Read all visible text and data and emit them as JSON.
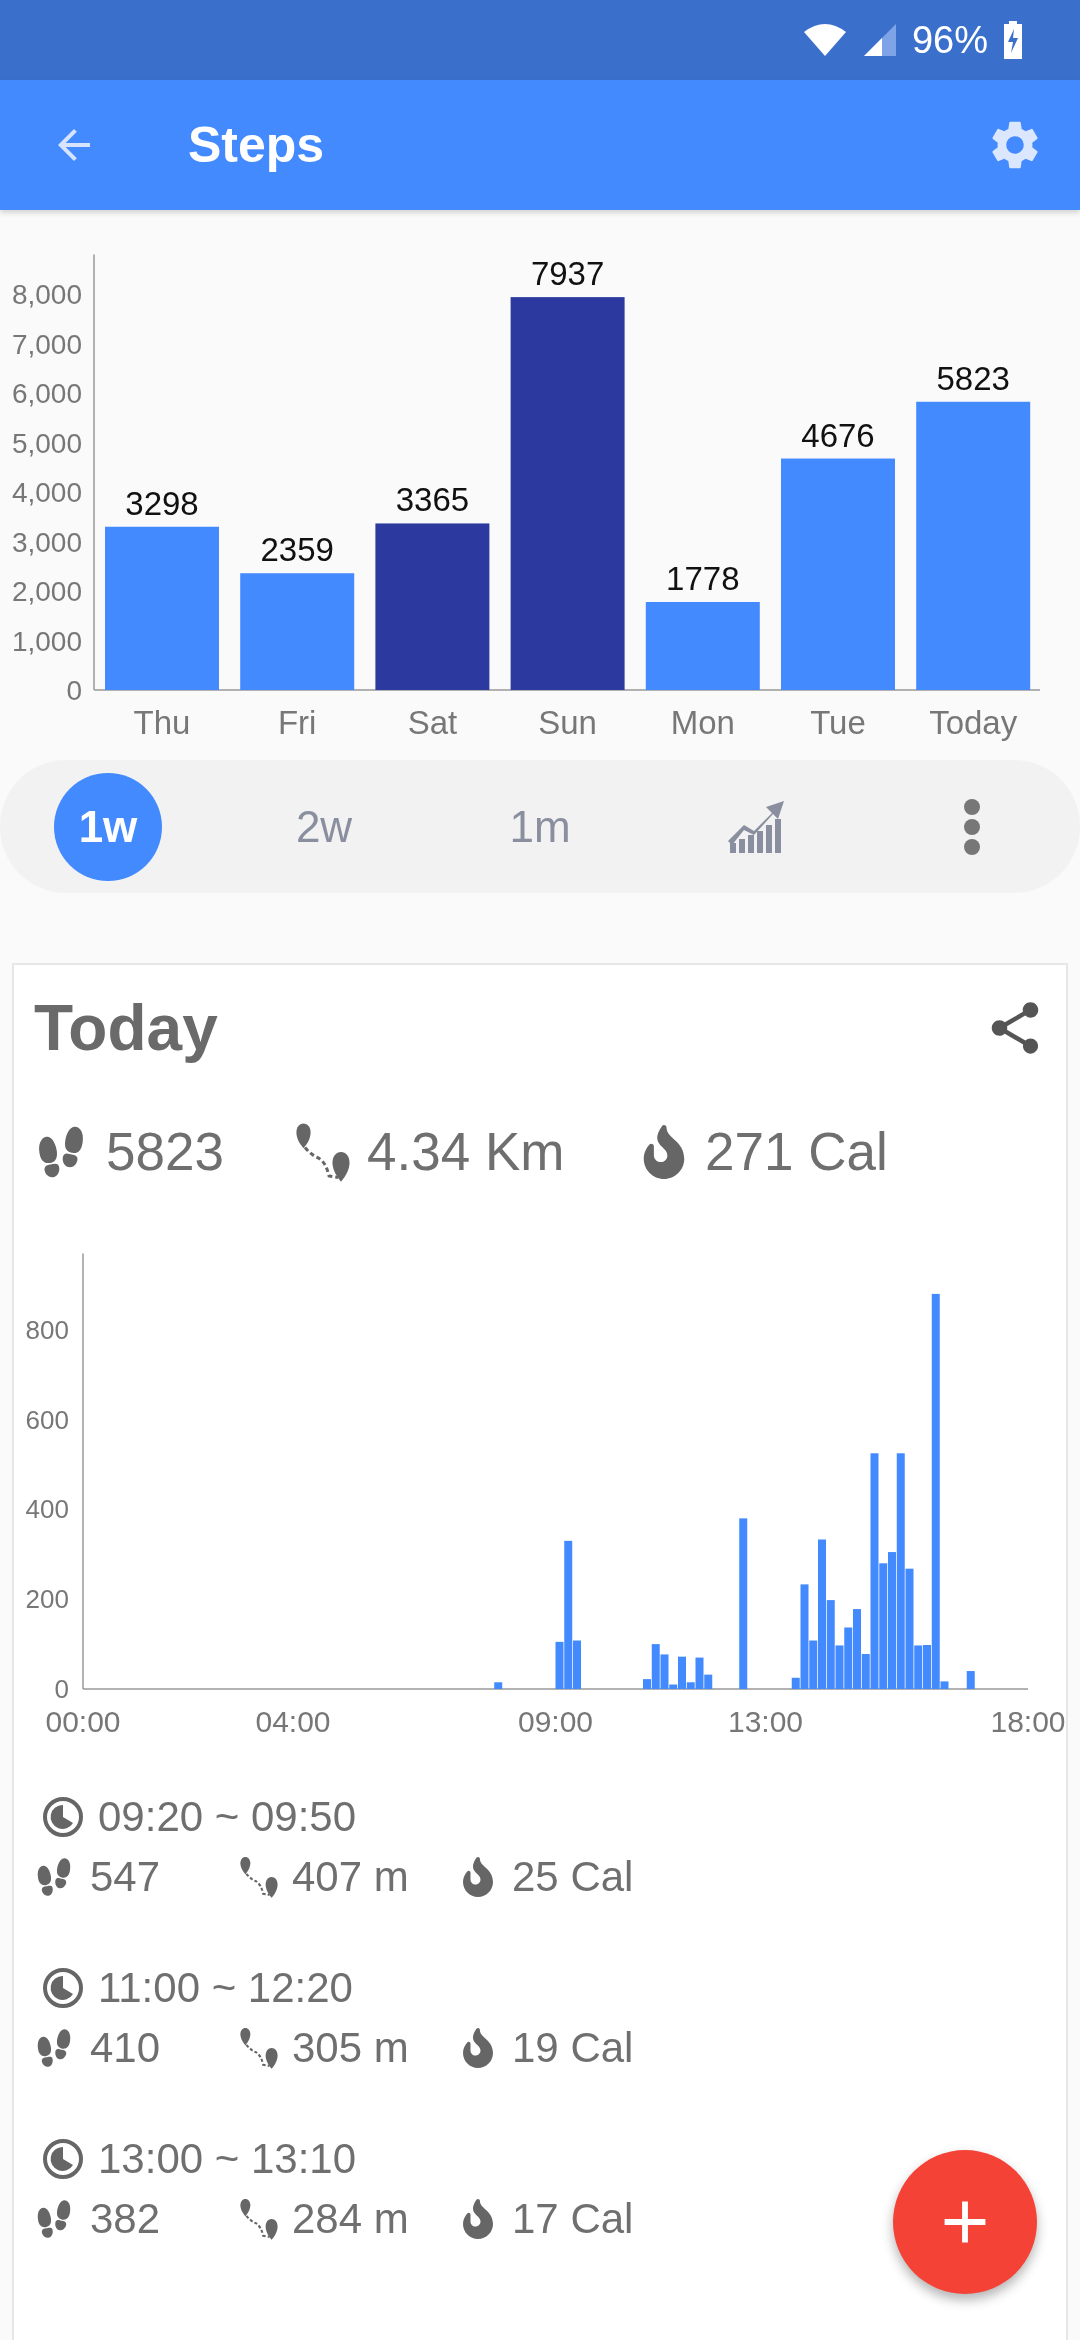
{
  "status_bar": {
    "battery": "96%"
  },
  "app_bar": {
    "title": "Steps"
  },
  "weekly_chart": {
    "chart_data": {
      "type": "bar",
      "categories": [
        "Thu",
        "Fri",
        "Sat",
        "Sun",
        "Mon",
        "Tue",
        "Today"
      ],
      "data_labels": true,
      "ylim": [
        0,
        8800
      ],
      "yticks": [
        {
          "value": 0,
          "label": "0"
        },
        {
          "value": 1000,
          "label": "1,000"
        },
        {
          "value": 2000,
          "label": "2,000"
        },
        {
          "value": 3000,
          "label": "3,000"
        },
        {
          "value": 4000,
          "label": "4,000"
        },
        {
          "value": 5000,
          "label": "5,000"
        },
        {
          "value": 6000,
          "label": "6,000"
        },
        {
          "value": 7000,
          "label": "7,000"
        },
        {
          "value": 8000,
          "label": "8,000"
        }
      ],
      "series": [
        {
          "color": "#448aff",
          "values": [
            3298,
            2359,
            null,
            null,
            1778,
            4676,
            5823
          ]
        },
        {
          "color": "#2c3a9f",
          "values": [
            null,
            null,
            3365,
            7937,
            null,
            null,
            null
          ]
        }
      ]
    }
  },
  "periods": [
    {
      "label": "1w",
      "selected": true
    },
    {
      "label": "2w",
      "selected": false
    },
    {
      "label": "1m",
      "selected": false
    }
  ],
  "summary": {
    "title": "Today",
    "steps": "5823",
    "distance": "4.34 Km",
    "calories": "271 Cal"
  },
  "hourly_chart": {
    "chart_data": {
      "type": "bar",
      "xlim": [
        0,
        1080
      ],
      "ylim": [
        0,
        970
      ],
      "xticks": [
        {
          "value": 0,
          "label": "00:00"
        },
        {
          "value": 240,
          "label": "04:00"
        },
        {
          "value": 540,
          "label": "09:00"
        },
        {
          "value": 780,
          "label": "13:00"
        },
        {
          "value": 1080,
          "label": "18:00"
        }
      ],
      "yticks": [
        0,
        200,
        400,
        600,
        800
      ],
      "x": [
        470,
        540,
        550,
        560,
        640,
        650,
        660,
        670,
        680,
        690,
        700,
        710,
        750,
        810,
        820,
        830,
        840,
        850,
        860,
        870,
        880,
        890,
        900,
        910,
        920,
        930,
        940,
        950,
        960,
        970,
        980,
        1010
      ],
      "series": [
        {
          "color": "#448aff",
          "values": [
            15,
            105,
            330,
            108,
            22,
            100,
            77,
            10,
            72,
            15,
            70,
            32,
            380,
            25,
            233,
            108,
            333,
            198,
            97,
            137,
            178,
            78,
            525,
            280,
            305,
            525,
            268,
            97,
            98,
            880,
            17,
            40
          ]
        }
      ]
    }
  },
  "sessions": [
    {
      "time": "09:20 ~ 09:50",
      "steps": "547",
      "distance": "407 m",
      "calories": "25 Cal"
    },
    {
      "time": "11:00 ~ 12:20",
      "steps": "410",
      "distance": "305 m",
      "calories": "19 Cal"
    },
    {
      "time": "13:00 ~ 13:10",
      "steps": "382",
      "distance": "284 m",
      "calories": "17 Cal"
    }
  ]
}
